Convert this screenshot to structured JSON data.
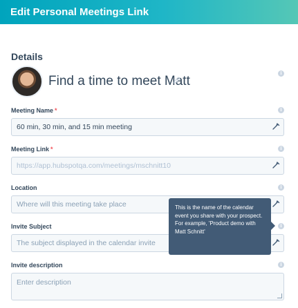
{
  "header": {
    "title": "Edit Personal Meetings Link"
  },
  "details": {
    "section_title": "Details",
    "heading": "Find a time to meet Matt"
  },
  "fields": {
    "meeting_name": {
      "label": "Meeting Name",
      "required_mark": "*",
      "value": "60 min, 30 min, and 15 min meeting"
    },
    "meeting_link": {
      "label": "Meeting Link",
      "required_mark": "*",
      "value": "https://app.hubspotqa.com/meetings/mschnitt10"
    },
    "location": {
      "label": "Location",
      "placeholder": "Where will this meeting take place"
    },
    "invite_subject": {
      "label": "Invite Subject",
      "placeholder": "The subject displayed in the calendar invite"
    },
    "invite_description": {
      "label": "Invite description",
      "placeholder": "Enter description"
    }
  },
  "tooltip": {
    "text": "This is the name of the calendar event you share with your prospect. For example, 'Product demo with Matt Schnitt'"
  },
  "icons": {
    "info": "info-icon",
    "edit": "pencil-icon",
    "tool": "wrench-icon"
  },
  "colors": {
    "header_start": "#00a4bd",
    "header_end": "#55c7b6",
    "required": "#f2545b",
    "tooltip_bg": "#425b76"
  }
}
